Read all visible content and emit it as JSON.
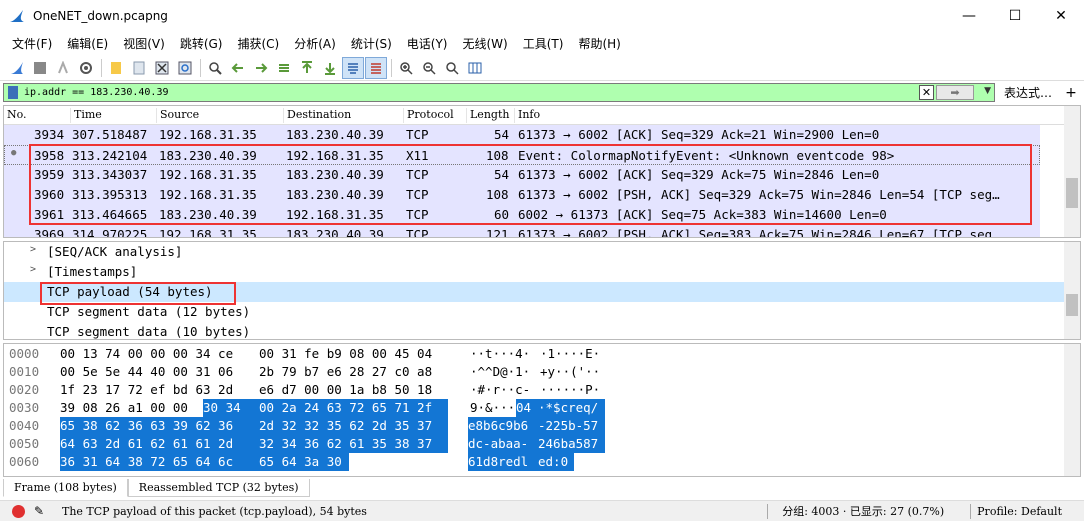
{
  "window": {
    "title": "OneNET_down.pcapng",
    "minimize": "—",
    "maximize": "☐",
    "close": "✕"
  },
  "menu": [
    "文件(F)",
    "编辑(E)",
    "视图(V)",
    "跳转(G)",
    "捕获(C)",
    "分析(A)",
    "统计(S)",
    "电话(Y)",
    "无线(W)",
    "工具(T)",
    "帮助(H)"
  ],
  "filter": {
    "value": "ip.addr == 183.230.40.39",
    "expression_label": "表达式…",
    "plus": "+"
  },
  "packet_list": {
    "columns": [
      "No.",
      "Time",
      "Source",
      "Destination",
      "Protocol",
      "Length",
      "Info"
    ],
    "rows": [
      {
        "no": "3934",
        "time": "307.518487",
        "src": "192.168.31.35",
        "dst": "183.230.40.39",
        "proto": "TCP",
        "len": "54",
        "info": "61373 → 6002 [ACK] Seq=329 Ack=21 Win=2900 Len=0"
      },
      {
        "no": "3958",
        "time": "313.242104",
        "src": "183.230.40.39",
        "dst": "192.168.31.35",
        "proto": "X11",
        "len": "108",
        "info": "Event: ColormapNotifyEvent: <Unknown eventcode 98>"
      },
      {
        "no": "3959",
        "time": "313.343037",
        "src": "192.168.31.35",
        "dst": "183.230.40.39",
        "proto": "TCP",
        "len": "54",
        "info": "61373 → 6002 [ACK] Seq=329 Ack=75 Win=2846 Len=0"
      },
      {
        "no": "3960",
        "time": "313.395313",
        "src": "192.168.31.35",
        "dst": "183.230.40.39",
        "proto": "TCP",
        "len": "108",
        "info": "61373 → 6002 [PSH, ACK] Seq=329 Ack=75 Win=2846 Len=54 [TCP seg…"
      },
      {
        "no": "3961",
        "time": "313.464665",
        "src": "183.230.40.39",
        "dst": "192.168.31.35",
        "proto": "TCP",
        "len": "60",
        "info": "6002 → 61373 [ACK] Seq=75 Ack=383 Win=14600 Len=0"
      },
      {
        "no": "3969",
        "time": "314.970225",
        "src": "192.168.31.35",
        "dst": "183.230.40.39",
        "proto": "TCP",
        "len": "121",
        "info": "61373 → 6002 [PSH, ACK] Seq=383 Ack=75 Win=2846 Len=67 [TCP seg…"
      }
    ]
  },
  "details": [
    {
      "arrow": ">",
      "text": "[SEQ/ACK analysis]"
    },
    {
      "arrow": ">",
      "text": "[Timestamps]"
    },
    {
      "arrow": "",
      "text": "TCP payload (54 bytes)"
    },
    {
      "arrow": "",
      "text": "TCP segment data (12 bytes)"
    },
    {
      "arrow": "",
      "text": "TCP segment data (10 bytes)"
    }
  ],
  "bytes": [
    {
      "off": "0000",
      "hex_a": "00 13 74 00 00 00 34 ce",
      "hex_b": "00 31 fe b9 08 00 45 04",
      "asc_a": "··t···4·",
      "asc_b": "·1····E·"
    },
    {
      "off": "0010",
      "hex_a": "00 5e 5e 44 40 00 31 06",
      "hex_b": "2b 79 b7 e6 28 27 c0 a8",
      "asc_a": "·^^D@·1·",
      "asc_b": "+y··('··"
    },
    {
      "off": "0020",
      "hex_a": "1f 23 17 72 ef bd 63 2d",
      "hex_b": "e6 d7 00 00 1a b8 50 18",
      "asc_a": "·#·r··c-",
      "asc_b": "······P·"
    },
    {
      "off": "0030",
      "hex_a": "39 08 26 a1 00 00",
      "hex_a2": "30 34",
      "hex_b": "00 2a 24 63 72 65 71 2f",
      "asc_a": "9·&···",
      "asc_a2": "04",
      "asc_b": "·*$creq/"
    },
    {
      "off": "0040",
      "hex_a": "65 38 62 36 63 39 62 36",
      "hex_b": "2d 32 32 35 62 2d 35 37",
      "asc_a": "e8b6c9b6",
      "asc_b": "-225b-57"
    },
    {
      "off": "0050",
      "hex_a": "64 63 2d 61 62 61 61 2d",
      "hex_b": "32 34 36 62 61 35 38 37",
      "asc_a": "dc-abaa-",
      "asc_b": "246ba587"
    },
    {
      "off": "0060",
      "hex_a": "36 31 64 38 72 65 64 6c",
      "hex_b": "65 64 3a 30",
      "asc_a": "61d8redl",
      "asc_b": "ed:0"
    }
  ],
  "byte_tabs": [
    "Frame (108 bytes)",
    "Reassembled TCP (32 bytes)"
  ],
  "status": {
    "message": "The TCP payload of this packet (tcp.payload), 54 bytes",
    "packets": "分组: 4003 · 已显示: 27 (0.7%)",
    "profile": "Profile: Default"
  }
}
